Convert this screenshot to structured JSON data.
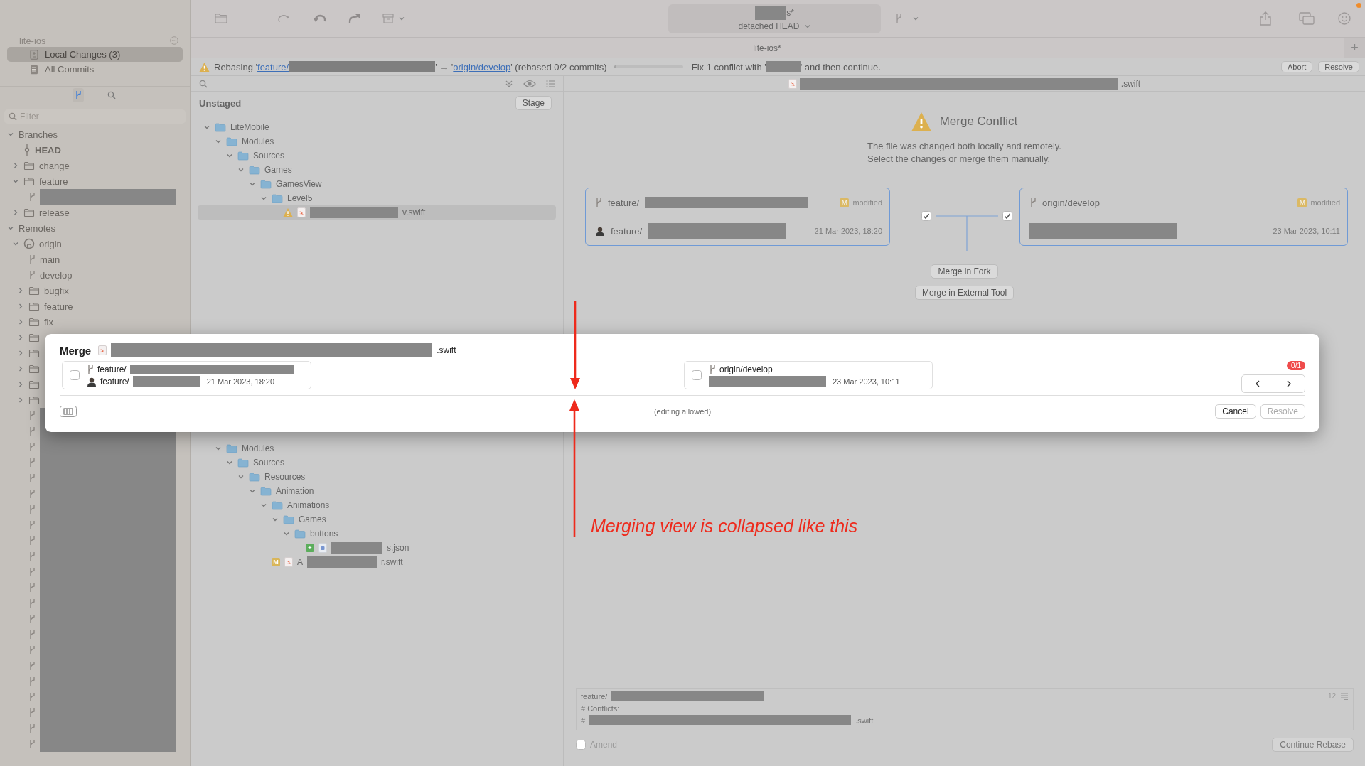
{
  "toolbar": {
    "repo_suffix": "s*",
    "head_state": "detached HEAD",
    "tab": {
      "label": "lite-ios*",
      "selected": true
    },
    "add_tab": "+"
  },
  "sidebar": {
    "repo": "lite-ios",
    "nav": [
      {
        "kind": "changes",
        "label": "Local Changes (3)",
        "selected": true
      },
      {
        "kind": "commits",
        "label": "All Commits",
        "selected": false
      }
    ],
    "view_tabs": [
      {
        "kind": "branches",
        "selected": true
      },
      {
        "kind": "search",
        "selected": false
      }
    ],
    "filter": {
      "placeholder": "Filter"
    },
    "tree": [
      {
        "kind": "section",
        "label": "Branches",
        "expanded": true,
        "children": [
          {
            "kind": "head",
            "label": "HEAD"
          },
          {
            "kind": "folder",
            "label": "change",
            "expanded": false
          },
          {
            "kind": "folder",
            "label": "feature",
            "expanded": true,
            "children": [
              {
                "kind": "branch",
                "redacted": true
              }
            ]
          },
          {
            "kind": "folder",
            "label": "release",
            "expanded": false
          }
        ]
      },
      {
        "kind": "section",
        "label": "Remotes",
        "expanded": true,
        "children": [
          {
            "kind": "remote",
            "label": "origin",
            "expanded": true,
            "children": [
              {
                "kind": "branch",
                "label": "main"
              },
              {
                "kind": "branch",
                "label": "develop"
              },
              {
                "kind": "folder",
                "label": "bugfix",
                "expanded": false
              },
              {
                "kind": "folder",
                "label": "feature",
                "expanded": false
              },
              {
                "kind": "folder",
                "label": "fix",
                "expanded": false
              },
              {
                "kind": "folder",
                "expanded": false
              },
              {
                "kind": "folder",
                "expanded": false
              },
              {
                "kind": "folder",
                "expanded": false
              },
              {
                "kind": "folder",
                "expanded": false
              },
              {
                "kind": "folder",
                "expanded": false
              },
              {
                "kind": "branch",
                "redacted": true
              },
              {
                "kind": "branch",
                "redacted": true
              },
              {
                "kind": "branch",
                "redacted": true
              },
              {
                "kind": "branch",
                "redacted": true
              },
              {
                "kind": "branch",
                "redacted": true
              },
              {
                "kind": "branch",
                "redacted": true
              },
              {
                "kind": "branch",
                "redacted": true
              },
              {
                "kind": "branch",
                "redacted": true
              },
              {
                "kind": "branch",
                "redacted": true
              },
              {
                "kind": "branch",
                "redacted": true
              },
              {
                "kind": "branch",
                "redacted": true
              },
              {
                "kind": "branch",
                "redacted": true
              },
              {
                "kind": "branch",
                "redacted": true
              },
              {
                "kind": "branch",
                "redacted": true
              },
              {
                "kind": "branch",
                "redacted": true
              },
              {
                "kind": "branch",
                "redacted": true
              },
              {
                "kind": "branch",
                "redacted": true
              },
              {
                "kind": "branch",
                "redacted": true
              },
              {
                "kind": "branch",
                "redacted": true
              },
              {
                "kind": "branch",
                "redacted": true
              },
              {
                "kind": "branch",
                "redacted": true
              },
              {
                "kind": "branch",
                "redacted": true
              }
            ]
          }
        ]
      }
    ]
  },
  "rebase": {
    "prefix": "Rebasing '",
    "source": "feature/",
    "middle": "' → '",
    "target": "origin/develop",
    "suffix": "' (rebased 0/2 commits)",
    "level": 0.03,
    "message_start": "Fix 1 conflict with '",
    "message_end": "' and then continue.",
    "buttons": [
      "Abort",
      "Resolve"
    ]
  },
  "changes": {
    "unstaged": {
      "title": "Unstaged",
      "action": "Stage",
      "tree": [
        {
          "kind": "folder",
          "label": "LiteMobile",
          "expanded": true,
          "children": [
            {
              "kind": "folder",
              "label": "Modules",
              "expanded": true,
              "children": [
                {
                  "kind": "folder",
                  "label": "Sources",
                  "expanded": true,
                  "children": [
                    {
                      "kind": "folder",
                      "label": "Games",
                      "expanded": true,
                      "children": [
                        {
                          "kind": "folder",
                          "label": "GamesView",
                          "expanded": true,
                          "children": [
                            {
                              "kind": "folder",
                              "label": "Level5",
                              "expanded": true,
                              "children": [
                                {
                                  "kind": "conflicted",
                                  "name_end": "v.swift",
                                  "selected": true
                                }
                              ]
                            }
                          ]
                        }
                      ]
                    }
                  ]
                }
              ]
            }
          ]
        }
      ]
    },
    "staged_tree": [
      {
        "kind": "folder",
        "label": "Modules",
        "expanded": true,
        "children": [
          {
            "kind": "folder",
            "label": "Sources",
            "expanded": true,
            "children": [
              {
                "kind": "folder",
                "label": "Resources",
                "expanded": true,
                "children": [
                  {
                    "kind": "folder",
                    "label": "Animation",
                    "expanded": true,
                    "children": [
                      {
                        "kind": "folder",
                        "label": "Animations",
                        "expanded": true,
                        "children": [
                          {
                            "kind": "folder",
                            "label": "Games",
                            "expanded": true,
                            "children": [
                              {
                                "kind": "folder",
                                "label": "buttons",
                                "expanded": true,
                                "children": [
                                  {
                                    "kind": "added",
                                    "badge": "+",
                                    "name_end": "s.json",
                                    "selected": false
                                  }
                                ]
                              }
                            ]
                          }
                        ]
                      },
                      {
                        "kind": "modified",
                        "badge": "M",
                        "name_start": "A",
                        "name_end": "r.swift",
                        "selected": false
                      }
                    ]
                  }
                ]
              }
            ]
          }
        ]
      }
    ]
  },
  "conflict": {
    "file_end": ".swift",
    "title": "Merge Conflict",
    "description": [
      "The file was changed both locally and remotely.",
      "Select the changes or merge them manually."
    ],
    "sides": [
      {
        "branch": "feature/",
        "badge": "M",
        "state": "modified",
        "avatar": true,
        "commit": "feature/",
        "date": "21 Mar 2023, 18:20",
        "checked": true
      },
      {
        "branch": "origin/develop",
        "badge": "M",
        "state": "modified",
        "avatar": false,
        "date": "23 Mar 2023, 10:11",
        "checked": true
      }
    ],
    "actions": [
      "Merge in Fork",
      "Merge in External Tool"
    ]
  },
  "commit": {
    "lines": [
      {
        "start": "feature/",
        "redacted": true
      },
      {
        "start": "# Conflicts:",
        "redacted": false
      },
      {
        "start": "#",
        "redacted": true,
        "end": ".swift"
      }
    ],
    "count": "12",
    "amend": {
      "label": "Amend",
      "checked": false
    },
    "button": {
      "label": "Continue Rebase",
      "disabled": true
    }
  },
  "merge_dialog": {
    "title": "Merge",
    "file_end": ".swift",
    "sides": [
      {
        "branch": "feature/",
        "avatar": true,
        "commit": "feature/",
        "date": "21 Mar 2023, 18:20",
        "checked": false
      },
      {
        "branch": "origin/develop",
        "avatar": false,
        "date": "23 Mar 2023, 10:11",
        "checked": false
      }
    ],
    "conflict_count": "0/1",
    "hint": "(editing allowed)",
    "buttons": [
      {
        "label": "Cancel",
        "disabled": false
      },
      {
        "label": "Resolve",
        "disabled": true
      }
    ]
  },
  "annotation": {
    "text": "Merging view is collapsed like this"
  }
}
